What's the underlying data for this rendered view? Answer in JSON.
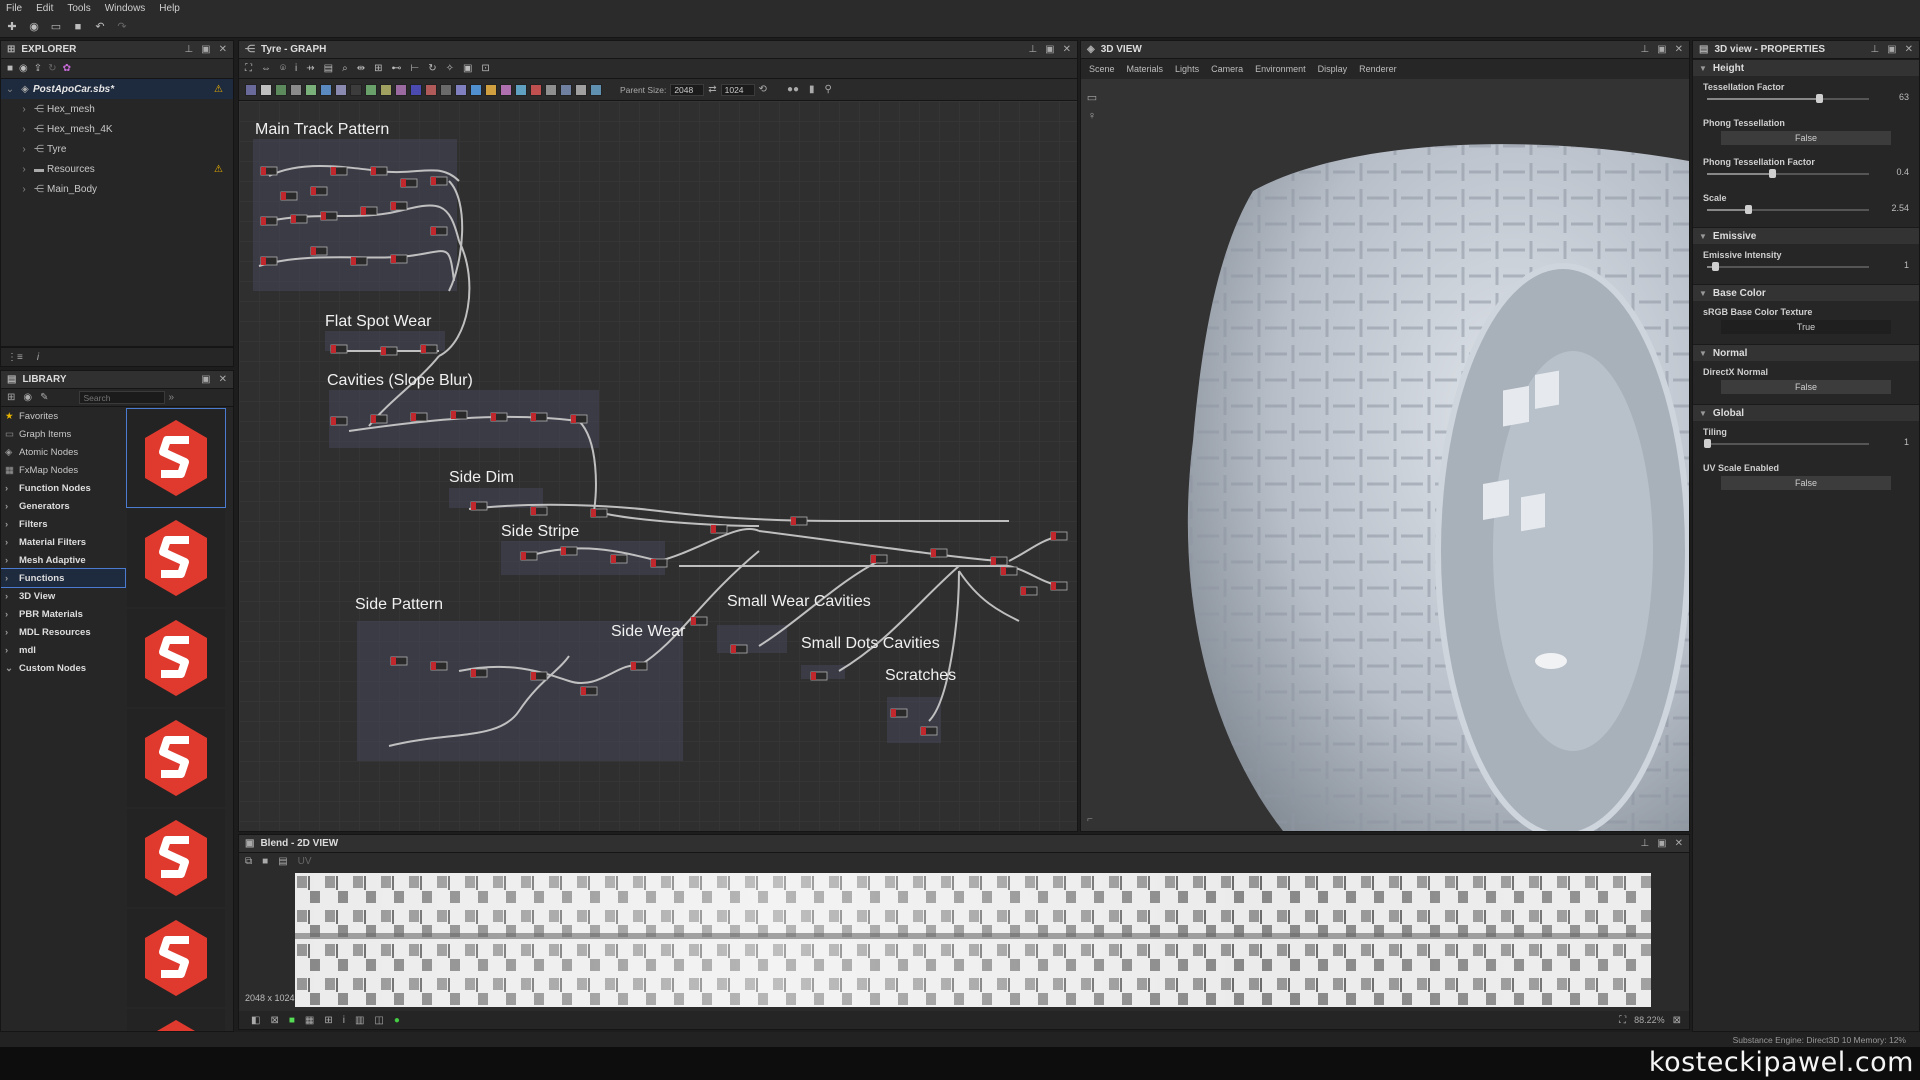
{
  "menu": {
    "items": [
      "File",
      "Edit",
      "Tools",
      "Windows",
      "Help"
    ]
  },
  "explorer": {
    "title": "EXPLORER",
    "package": "PostApoCar.sbs*",
    "items": [
      {
        "label": "Hex_mesh",
        "icon": "graph-icon"
      },
      {
        "label": "Hex_mesh_4K",
        "icon": "graph-icon"
      },
      {
        "label": "Tyre",
        "icon": "graph-icon"
      },
      {
        "label": "Resources",
        "icon": "folder-icon",
        "warning": true
      },
      {
        "label": "Main_Body",
        "icon": "graph-icon"
      }
    ]
  },
  "library": {
    "title": "LIBRARY",
    "search_placeholder": "Search",
    "categories": [
      {
        "label": "Favorites",
        "bold": false,
        "icon": "star-icon"
      },
      {
        "label": "Graph Items",
        "bold": false,
        "icon": "graph-items-icon"
      },
      {
        "label": "Atomic Nodes",
        "bold": false,
        "icon": "atomic-icon"
      },
      {
        "label": "FxMap Nodes",
        "bold": false,
        "icon": "fxmap-icon"
      },
      {
        "label": "Function Nodes",
        "bold": true,
        "icon": "chevron-right-icon"
      },
      {
        "label": "Generators",
        "bold": true,
        "icon": "chevron-right-icon"
      },
      {
        "label": "Filters",
        "bold": true,
        "icon": "chevron-right-icon"
      },
      {
        "label": "Material Filters",
        "bold": true,
        "icon": "chevron-right-icon"
      },
      {
        "label": "Mesh Adaptive",
        "bold": true,
        "icon": "chevron-right-icon"
      },
      {
        "label": "Functions",
        "bold": true,
        "icon": "chevron-right-icon",
        "selected": true
      },
      {
        "label": "3D View",
        "bold": true,
        "icon": "chevron-right-icon"
      },
      {
        "label": "PBR Materials",
        "bold": true,
        "icon": "chevron-right-icon"
      },
      {
        "label": "MDL Resources",
        "bold": true,
        "icon": "chevron-right-icon"
      },
      {
        "label": "mdl",
        "bold": true,
        "icon": "chevron-right-icon"
      },
      {
        "label": "Custom Nodes",
        "bold": true,
        "icon": "chevron-down-icon"
      }
    ]
  },
  "graph": {
    "title": "Tyre - GRAPH",
    "parent_size_label": "Parent Size:",
    "parent_size_value": "2048",
    "output_size_value": "1024",
    "frames": {
      "main_track": "Main Track Pattern",
      "flat_spot": "Flat Spot Wear",
      "cavities": "Cavities (Slope Blur)",
      "side_dim": "Side Dim",
      "side_stripe": "Side Stripe",
      "side_pattern": "Side Pattern",
      "side_wear": "Side Wear",
      "small_wear": "Small Wear Cavities",
      "small_dots": "Small Dots Cavities",
      "scratches": "Scratches"
    }
  },
  "view3d": {
    "title": "3D VIEW",
    "tabs": [
      "Scene",
      "Materials",
      "Lights",
      "Camera",
      "Environment",
      "Display",
      "Renderer"
    ]
  },
  "properties": {
    "title": "3D view - PROPERTIES",
    "sections": {
      "height": "Height",
      "emissive": "Emissive",
      "base_color": "Base Color",
      "normal": "Normal",
      "global": "Global"
    },
    "tessellation_factor": {
      "label": "Tessellation Factor",
      "value": "63",
      "fraction": 0.69
    },
    "phong_tessellation": {
      "label": "Phong Tessellation",
      "value": "False"
    },
    "phong_tessellation_factor": {
      "label": "Phong Tessellation Factor",
      "value": "0.4",
      "fraction": 0.4
    },
    "scale": {
      "label": "Scale",
      "value": "2.54",
      "fraction": 0.25
    },
    "emissive_intensity": {
      "label": "Emissive Intensity",
      "value": "1",
      "fraction": 0.05
    },
    "srgb_base_color_texture": {
      "label": "sRGB Base Color Texture",
      "value": "True"
    },
    "directx_normal": {
      "label": "DirectX Normal",
      "value": "False"
    },
    "tiling": {
      "label": "Tiling",
      "value": "1",
      "fraction": 0.0
    },
    "uv_scale_enabled": {
      "label": "UV Scale Enabled",
      "value": "False"
    }
  },
  "view2d": {
    "title": "Blend - 2D VIEW",
    "resolution": "2048 x 1024",
    "zoom": "88.22%"
  },
  "status": {
    "text": "Substance Engine: Direct3D 10   Memory: 12%"
  },
  "watermark": "kosteckipawel.com"
}
